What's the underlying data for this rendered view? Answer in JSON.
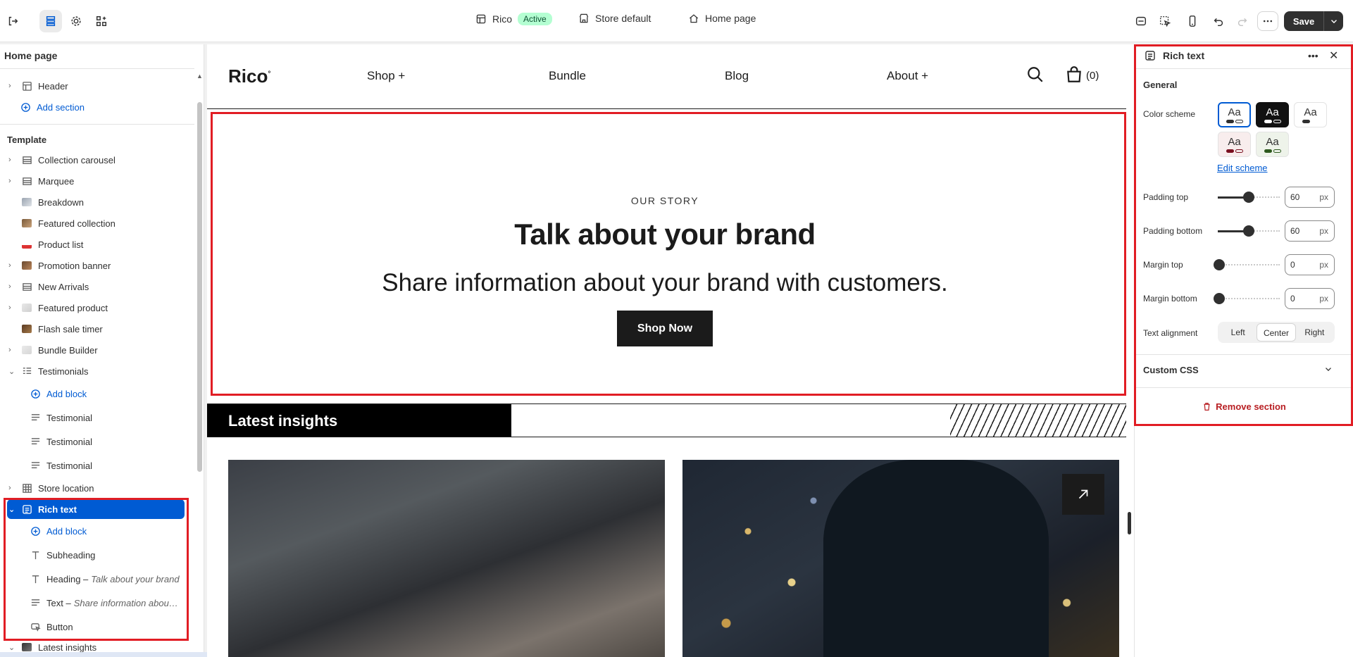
{
  "topbar": {
    "theme_name": "Rico",
    "theme_status": "Active",
    "store_label": "Store default",
    "page_label": "Home page",
    "save_label": "Save"
  },
  "sidebar": {
    "title": "Home page",
    "header_item": "Header",
    "add_section": "Add section",
    "template_label": "Template",
    "sections": [
      "Collection carousel",
      "Marquee",
      "Breakdown",
      "Featured collection",
      "Product list",
      "Promotion banner",
      "New Arrivals",
      "Featured product",
      "Flash sale timer",
      "Bundle Builder",
      "Testimonials"
    ],
    "testimonials_add_block": "Add block",
    "testimonial_blocks": [
      "Testimonial",
      "Testimonial",
      "Testimonial"
    ],
    "store_location": "Store location",
    "rich_text": "Rich text",
    "rich_add_block": "Add block",
    "rich_blocks": {
      "subheading": "Subheading",
      "heading": "Heading –",
      "heading_detail": "Talk about your brand",
      "text": "Text –",
      "text_detail": "Share information about ...",
      "button": "Button"
    },
    "latest_insights": "Latest insights"
  },
  "preview": {
    "logo": "Rico",
    "nav": [
      "Shop +",
      "Bundle",
      "Blog",
      "About +"
    ],
    "cart_count": "(0)",
    "hero": {
      "subheading": "OUR STORY",
      "heading": "Talk about your brand",
      "text": "Share information about your brand with customers.",
      "button": "Shop Now"
    },
    "insights_title": "Latest insights"
  },
  "panel": {
    "title": "Rich text",
    "general": "General",
    "color_scheme_label": "Color scheme",
    "edit_scheme": "Edit scheme",
    "swatch_label": "Aa",
    "padding_top_label": "Padding top",
    "padding_top_value": "60",
    "padding_bottom_label": "Padding bottom",
    "padding_bottom_value": "60",
    "margin_top_label": "Margin top",
    "margin_top_value": "0",
    "margin_bottom_label": "Margin bottom",
    "margin_bottom_value": "0",
    "unit": "px",
    "text_alignment_label": "Text alignment",
    "align_options": [
      "Left",
      "Center",
      "Right"
    ],
    "align_selected": "Center",
    "custom_css": "Custom CSS",
    "remove_section": "Remove section"
  },
  "colors": {
    "accent": "#005bd3",
    "highlight_outline": "#e11d24",
    "remove": "#b81e22"
  }
}
